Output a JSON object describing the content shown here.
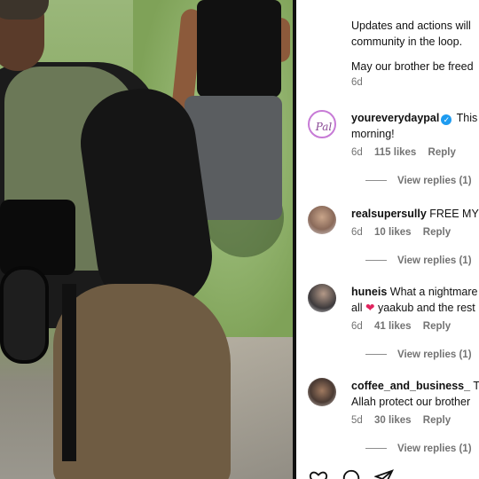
{
  "post": {
    "caption_lines": [
      "Updates and actions will",
      "community in the loop."
    ],
    "caption_line2": "May our brother be freed",
    "caption_age": "6d"
  },
  "comments": [
    {
      "username": "youreverydaypal",
      "verified": true,
      "text_line1": "This",
      "text_line2": "morning!",
      "age": "6d",
      "likes": "115 likes",
      "reply": "Reply",
      "view_replies": "View replies (1)",
      "avatar_letters": "Pal"
    },
    {
      "username": "realsupersully",
      "verified": false,
      "text_line1": "FREE MY",
      "text_line2": "",
      "age": "6d",
      "likes": "10 likes",
      "reply": "Reply",
      "view_replies": "View replies (1)"
    },
    {
      "username": "huneis",
      "verified": false,
      "text_line1": "What a nightmare",
      "text_line2_pre": "all",
      "text_line2_post": "yaakub and the rest",
      "age": "6d",
      "likes": "41 likes",
      "reply": "Reply",
      "view_replies": "View replies (1)"
    },
    {
      "username": "coffee_and_business_",
      "verified": false,
      "text_line1": "T",
      "text_line2": "Allah protect our brother",
      "age": "5d",
      "likes": "30 likes",
      "reply": "Reply",
      "view_replies": "View replies (1)"
    }
  ],
  "icons": {
    "like": "heart-outline-icon",
    "comment": "speech-bubble-icon",
    "share": "paper-plane-icon",
    "verified": "verified-badge-icon",
    "inline_heart": "red-heart-emoji"
  },
  "colors": {
    "meta_gray": "#737373",
    "verified_blue": "#1d9bf0",
    "heart_red": "#e0245e"
  }
}
